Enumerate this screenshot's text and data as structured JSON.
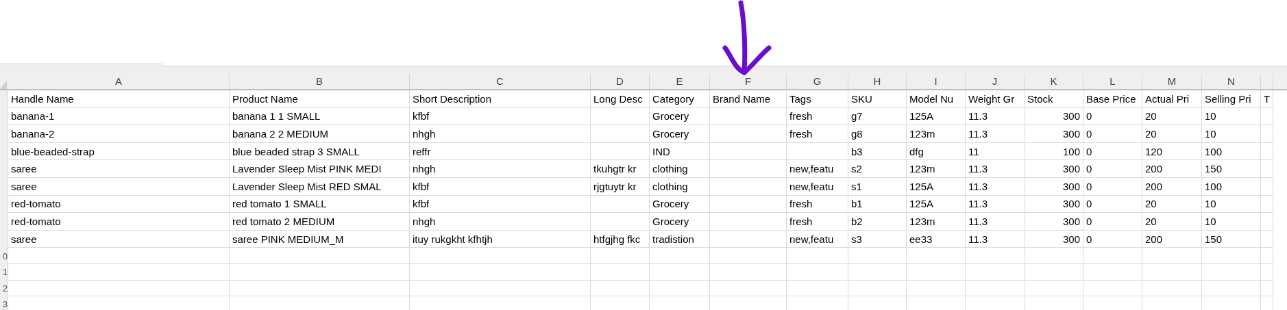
{
  "columns": [
    {
      "letter": "A"
    },
    {
      "letter": "B"
    },
    {
      "letter": "C"
    },
    {
      "letter": "D"
    },
    {
      "letter": "E"
    },
    {
      "letter": "F"
    },
    {
      "letter": "G"
    },
    {
      "letter": "H"
    },
    {
      "letter": "I"
    },
    {
      "letter": "J"
    },
    {
      "letter": "K"
    },
    {
      "letter": "L"
    },
    {
      "letter": "M"
    },
    {
      "letter": "N"
    },
    {}
  ],
  "rows": [
    [
      "Handle Name",
      "Product Name",
      "Short Description",
      "Long Desc",
      "Category",
      "Brand Name",
      "Tags",
      "SKU",
      "Model Nu",
      "Weight Gr",
      "Stock",
      "Base Price",
      "Actual Pri",
      "Selling Pri",
      "T"
    ],
    [
      "banana-1",
      "banana 1 1 SMALL",
      "kfbf",
      "",
      "Grocery",
      "",
      "fresh",
      "g7",
      "125A",
      "11.3",
      "300",
      "0",
      "20",
      "10",
      ""
    ],
    [
      "banana-2",
      "banana 2 2 MEDIUM",
      "nhgh",
      "",
      "Grocery",
      "",
      "fresh",
      "g8",
      "123m",
      "11.3",
      "300",
      "0",
      "20",
      "10",
      ""
    ],
    [
      "blue-beaded-strap",
      "blue beaded strap 3 SMALL",
      "reffr",
      "",
      "IND",
      "",
      "",
      "b3",
      "dfg",
      "11",
      "100",
      "0",
      "120",
      "100",
      ""
    ],
    [
      "saree",
      "Lavender Sleep Mist PINK MEDI",
      "nhgh",
      "tkuhgtr kr",
      "clothing",
      "",
      "new,featu",
      "s2",
      "123m",
      "11.3",
      "300",
      "0",
      "200",
      "150",
      ""
    ],
    [
      "saree",
      "Lavender Sleep Mist RED SMAL",
      "kfbf",
      "rjgtuytr kr",
      "clothing",
      "",
      "new,featu",
      "s1",
      "125A",
      "11.3",
      "300",
      "0",
      "200",
      "100",
      ""
    ],
    [
      "red-tomato",
      "red tomato 1 SMALL",
      "kfbf",
      "",
      "Grocery",
      "",
      "fresh",
      "b1",
      "125A",
      "11.3",
      "300",
      "0",
      "20",
      "10",
      ""
    ],
    [
      "red-tomato",
      "red tomato 2 MEDIUM",
      "nhgh",
      "",
      "Grocery",
      "",
      "fresh",
      "b2",
      "123m",
      "11.3",
      "300",
      "0",
      "20",
      "10",
      ""
    ],
    [
      "saree",
      "saree PINK MEDIUM_M",
      "ituy rukgkht kfhtjh",
      "htfgjhg fkc",
      "tradistion",
      "",
      "new,featu",
      "s3",
      "ee33",
      "11.3",
      "300",
      "0",
      "200",
      "150",
      ""
    ]
  ],
  "empty_rows": [
    {
      "row_header": "0"
    },
    {
      "row_header": "1"
    },
    {
      "row_header": "2"
    },
    {
      "row_header": "3"
    }
  ]
}
